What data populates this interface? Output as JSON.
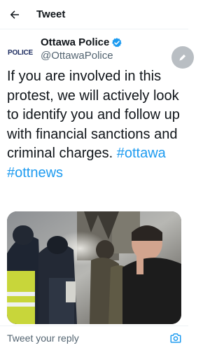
{
  "header": {
    "title": "Tweet",
    "back_icon": "arrow-left-icon"
  },
  "author": {
    "name": "Ottawa Police",
    "handle": "@OttawaPolice",
    "avatar_text": "POLICE",
    "verified_icon": "verified-badge-icon",
    "verified_color": "#1d9bf0"
  },
  "tweet": {
    "text_parts": [
      "If you are involved in this protest, we will actively look to identify you and follow up with financial sanctions and criminal charges. ",
      "#ottawa",
      " ",
      "#ottnews"
    ],
    "hashtag_color": "#1d9bf0"
  },
  "media": {
    "icon": "photo-protest-police-image"
  },
  "reply": {
    "placeholder": "Tweet your reply",
    "camera_icon": "camera-icon"
  },
  "compose": {
    "icon": "compose-feather-icon"
  }
}
